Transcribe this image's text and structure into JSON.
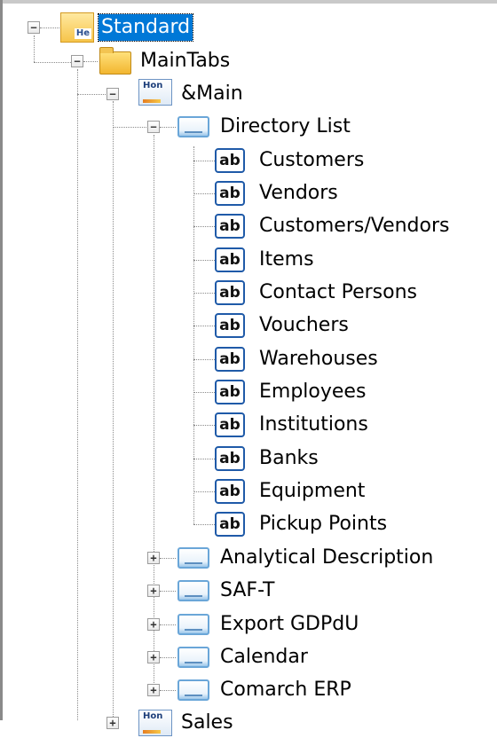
{
  "tree": {
    "root": {
      "label": "Standard",
      "expanded": true,
      "selected": true,
      "icon": "standard-form-icon"
    },
    "main_tabs": {
      "label": "MainTabs",
      "expanded": true,
      "icon": "folder-icon"
    },
    "main": {
      "label": "&Main",
      "expanded": true,
      "icon": "home-tab-icon"
    },
    "directory_list": {
      "label": "Directory List",
      "expanded": true,
      "icon": "tab-page-icon"
    },
    "directory_items": [
      {
        "label": "Customers"
      },
      {
        "label": "Vendors"
      },
      {
        "label": "Customers/Vendors"
      },
      {
        "label": "Items"
      },
      {
        "label": "Contact Persons"
      },
      {
        "label": "Vouchers"
      },
      {
        "label": "Warehouses"
      },
      {
        "label": "Employees"
      },
      {
        "label": "Institutions"
      },
      {
        "label": "Banks"
      },
      {
        "label": "Equipment"
      },
      {
        "label": "Pickup Points"
      }
    ],
    "item_icon_text": "ab",
    "collapsed_groups": [
      {
        "label": "Analytical Description"
      },
      {
        "label": "SAF-T"
      },
      {
        "label": "Export GDPdU"
      },
      {
        "label": "Calendar"
      },
      {
        "label": "Comarch ERP"
      }
    ],
    "next_tab": {
      "label": "Sales",
      "icon": "home-tab-icon"
    },
    "expand_glyph": "+",
    "collapse_glyph": "−"
  },
  "colors": {
    "selection": "#0078d7",
    "icon_border": "#1f5aa8"
  }
}
